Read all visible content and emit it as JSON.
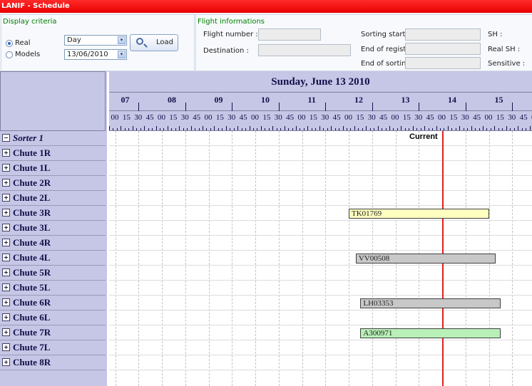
{
  "window": {
    "title": "LANIF - Schedule"
  },
  "display_criteria": {
    "title": "Display criteria",
    "radio_real": "Real",
    "radio_models": "Models",
    "selected_mode": "Real",
    "period_value": "Day",
    "date_value": "13/06/2010",
    "load_label": "Load"
  },
  "flight_info": {
    "title": "Flight informations",
    "flight_number_label": "Flight number :",
    "destination_label": "Destination :",
    "sorting_start_label": "Sorting start:",
    "end_regist_label": "End of regist. :",
    "end_sorting_label": "End of sorting :",
    "sh_label": "SH :",
    "real_sh_label": "Real SH :",
    "sensitive_label": "Sensitive :"
  },
  "schedule": {
    "date_title": "Sunday, June 13 2010",
    "hours": [
      "07",
      "08",
      "09",
      "10",
      "11",
      "12",
      "13",
      "14",
      "15"
    ],
    "minutes_pattern": [
      "15",
      "30",
      "45",
      "00"
    ],
    "current_label": "Current",
    "current_time_hours": 14.0,
    "rows": [
      {
        "label": "Sorter 1",
        "expander": "minus",
        "italic": true
      },
      {
        "label": "Chute 1R",
        "expander": "plus"
      },
      {
        "label": "Chute 1L",
        "expander": "plus"
      },
      {
        "label": "Chute 2R",
        "expander": "plus"
      },
      {
        "label": "Chute 2L",
        "expander": "plus"
      },
      {
        "label": "Chute 3R",
        "expander": "plus"
      },
      {
        "label": "Chute 3L",
        "expander": "plus"
      },
      {
        "label": "Chute 4R",
        "expander": "plus"
      },
      {
        "label": "Chute 4L",
        "expander": "plus"
      },
      {
        "label": "Chute 5R",
        "expander": "plus"
      },
      {
        "label": "Chute 5L",
        "expander": "plus"
      },
      {
        "label": "Chute 6R",
        "expander": "plus"
      },
      {
        "label": "Chute 6L",
        "expander": "plus"
      },
      {
        "label": "Chute 7R",
        "expander": "plus"
      },
      {
        "label": "Chute 7L",
        "expander": "plus"
      },
      {
        "label": "Chute 8R",
        "expander": "plus"
      }
    ],
    "flights": [
      {
        "code": "TK01769",
        "row": 5,
        "start": 12.0,
        "end": 15.0,
        "color": "#ffffc0"
      },
      {
        "code": "VV00508",
        "row": 8,
        "start": 12.15,
        "end": 15.15,
        "color": "#c8c8c8"
      },
      {
        "code": "LH03353",
        "row": 11,
        "start": 12.25,
        "end": 15.25,
        "color": "#c8c8c8"
      },
      {
        "code": "A300971",
        "row": 13,
        "start": 12.25,
        "end": 15.25,
        "color": "#b8f0b8"
      }
    ]
  }
}
